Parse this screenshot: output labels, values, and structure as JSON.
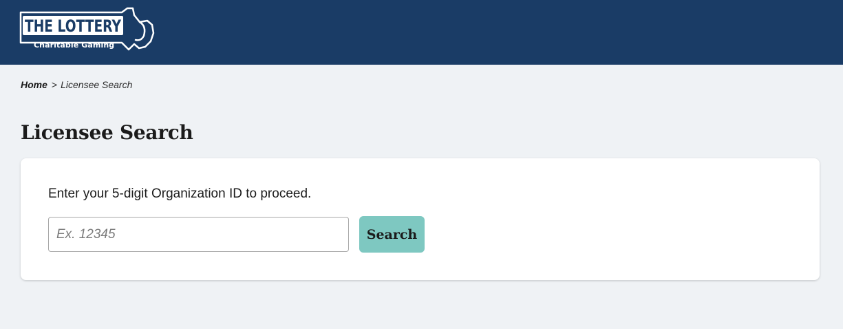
{
  "header": {
    "logo_text": "THE LOTTERY",
    "logo_tagline": "Charitable Gaming",
    "background_color": "#1a3c66",
    "logo_icon": "massachusetts-outline-icon"
  },
  "breadcrumb": {
    "home_label": "Home",
    "separator": ">",
    "current_label": "Licensee Search"
  },
  "page": {
    "title": "Licensee Search",
    "background_color": "#eff2f5"
  },
  "search_form": {
    "instructions": "Enter your 5-digit Organization ID to proceed.",
    "input_value": "",
    "input_placeholder": "Ex. 12345",
    "button_label": "Search",
    "button_color": "#7ec8c1"
  }
}
